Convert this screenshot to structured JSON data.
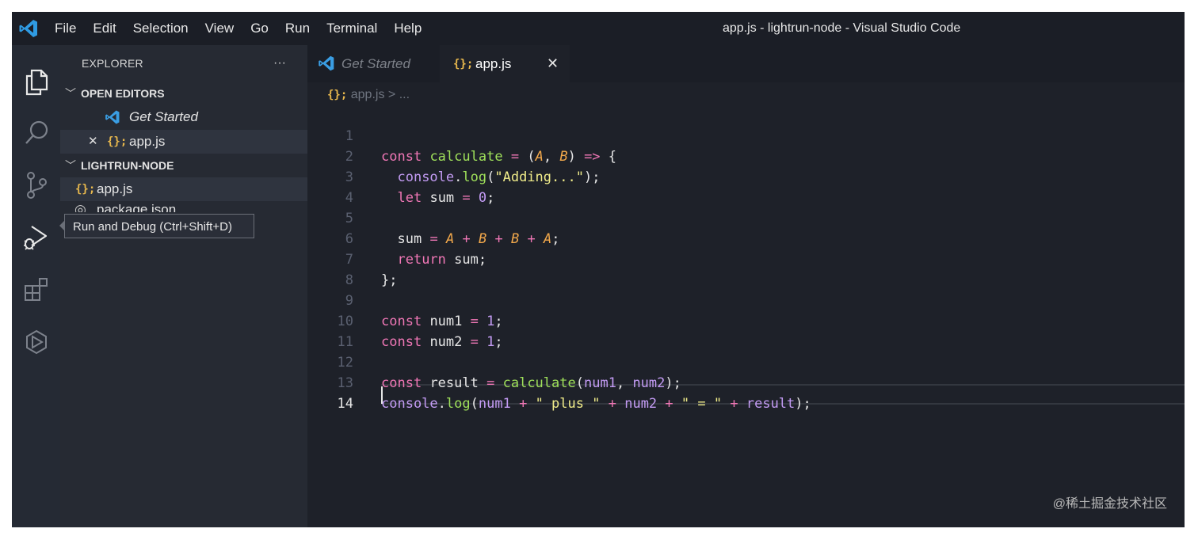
{
  "titlebar": {
    "menu": [
      "File",
      "Edit",
      "Selection",
      "View",
      "Go",
      "Run",
      "Terminal",
      "Help"
    ],
    "window_title": "app.js - lightrun-node - Visual Studio Code"
  },
  "activity_bar": {
    "items": [
      "explorer-icon",
      "search-icon",
      "source-control-icon",
      "run-debug-icon",
      "extensions-icon",
      "remote-icon"
    ]
  },
  "sidebar": {
    "title": "EXPLORER",
    "more": "···",
    "open_editors": {
      "heading": "OPEN EDITORS",
      "items": [
        "Get Started",
        "app.js"
      ]
    },
    "project": {
      "heading": "LIGHTRUN-NODE",
      "files": [
        "app.js",
        "package.json"
      ]
    },
    "close_glyph": "✕",
    "js_glyph": "{};"
  },
  "tooltip": {
    "text": "Run and Debug (Ctrl+Shift+D)"
  },
  "tabs": [
    {
      "label": "Get Started"
    },
    {
      "label": "app.js"
    }
  ],
  "tab_close": "✕",
  "breadcrumb": {
    "file": "app.js",
    "separator": ">",
    "more": "..."
  },
  "editor": {
    "line_numbers": [
      "1",
      "2",
      "3",
      "4",
      "5",
      "6",
      "7",
      "8",
      "9",
      "10",
      "11",
      "12",
      "13",
      "14"
    ],
    "code": {
      "l1": {
        "k": "const",
        "fn": "calculate",
        "eq": "=",
        "lp": "(",
        "a": "A",
        "comma": ",",
        "b": "B",
        "rp": ")",
        "arrow": "=>",
        "lb": "{"
      },
      "l2": {
        "obj": "console",
        "dot": ".",
        "fn": "log",
        "lp": "(",
        "str": "\"Adding...\"",
        "rp": ");"
      },
      "l3": {
        "k": "let",
        "v": "sum",
        "eq": "=",
        "n": "0",
        "semi": ";"
      },
      "l5": {
        "v": "sum",
        "eq": "=",
        "a1": "A",
        "p1": "+",
        "b1": "B",
        "p2": "+",
        "b2": "B",
        "p3": "+",
        "a2": "A",
        "semi": ";"
      },
      "l6": {
        "k": "return",
        "v": "sum",
        "semi": ";"
      },
      "l7": {
        "t": "};"
      },
      "l9": {
        "k": "const",
        "v": "num1",
        "eq": "=",
        "n": "1",
        "semi": ";"
      },
      "l10": {
        "k": "const",
        "v": "num2",
        "eq": "=",
        "n": "1",
        "semi": ";"
      },
      "l12": {
        "k": "const",
        "v": "result",
        "eq": "=",
        "fn": "calculate",
        "lp": "(",
        "a": "num1",
        "comma": ",",
        "b": "num2",
        "rp": ");"
      },
      "l13": {
        "obj": "console",
        "dot": ".",
        "fn": "log",
        "lp": "(",
        "a": "num1",
        "p1": "+",
        "s1": "\" plus \"",
        "p2": "+",
        "b": "num2",
        "p3": "+",
        "s2": "\" = \"",
        "p4": "+",
        "r": "result",
        "rp": ");"
      }
    }
  },
  "watermark": "@稀土掘金技术社区"
}
